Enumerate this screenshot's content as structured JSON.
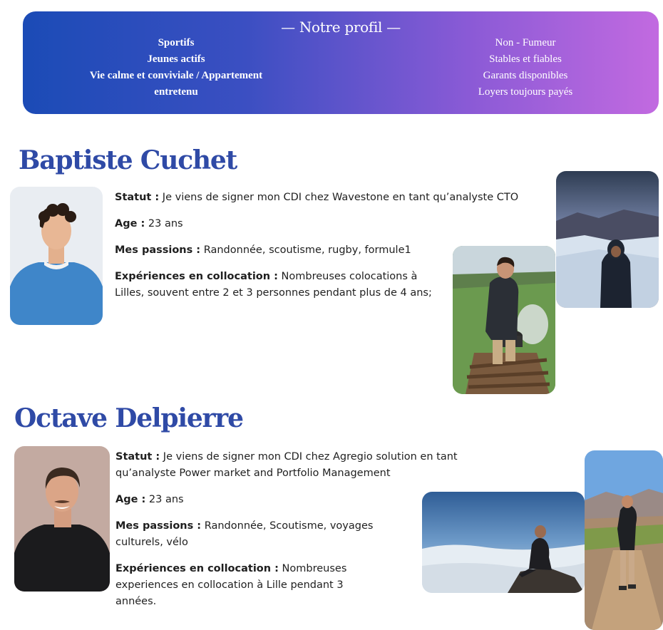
{
  "banner": {
    "title": "— Notre profil —",
    "left_items": [
      "Sportifs",
      "Jeunes actifs",
      "Vie calme et conviviale / Appartement",
      "entretenu"
    ],
    "right_items": [
      "Non - Fumeur",
      "Stables et fiables",
      "Garants disponibles",
      "Loyers toujours payés"
    ]
  },
  "people": [
    {
      "name": "Baptiste Cuchet",
      "statut_label": "Statut :",
      "statut_value": " Je viens de signer mon CDI chez Wavestone en tant qu’analyste CTO",
      "age_label": "Age :",
      "age_value": " 23 ans",
      "passions_label": "Mes passions :",
      "passions_value": " Randonnée, scoutisme, rugby, formule1",
      "experience_label": "Expériences en collocation :",
      "experience_value": " Nombreuses colocations à Lilles, souvent entre 2 et 3 personnes pendant plus de 4 ans;"
    },
    {
      "name": "Octave Delpierre",
      "statut_label": "Statut :",
      "statut_value": " Je viens de signer mon CDI chez Agregio solution en tant qu’analyste Power market and Portfolio Management",
      "age_label": "Age :",
      "age_value": " 23 ans",
      "passions_label": "Mes passions :",
      "passions_value": " Randonnée, Scoutisme, voyages culturels, vélo",
      "experience_label": "Expériences en collocation :",
      "experience_value": " Nombreuses experiences en collocation à Lille pendant 3 années."
    }
  ],
  "colors": {
    "banner_start": "#1b4bb6",
    "banner_end": "#c26ae0",
    "name_color": "#2f4aa6"
  }
}
